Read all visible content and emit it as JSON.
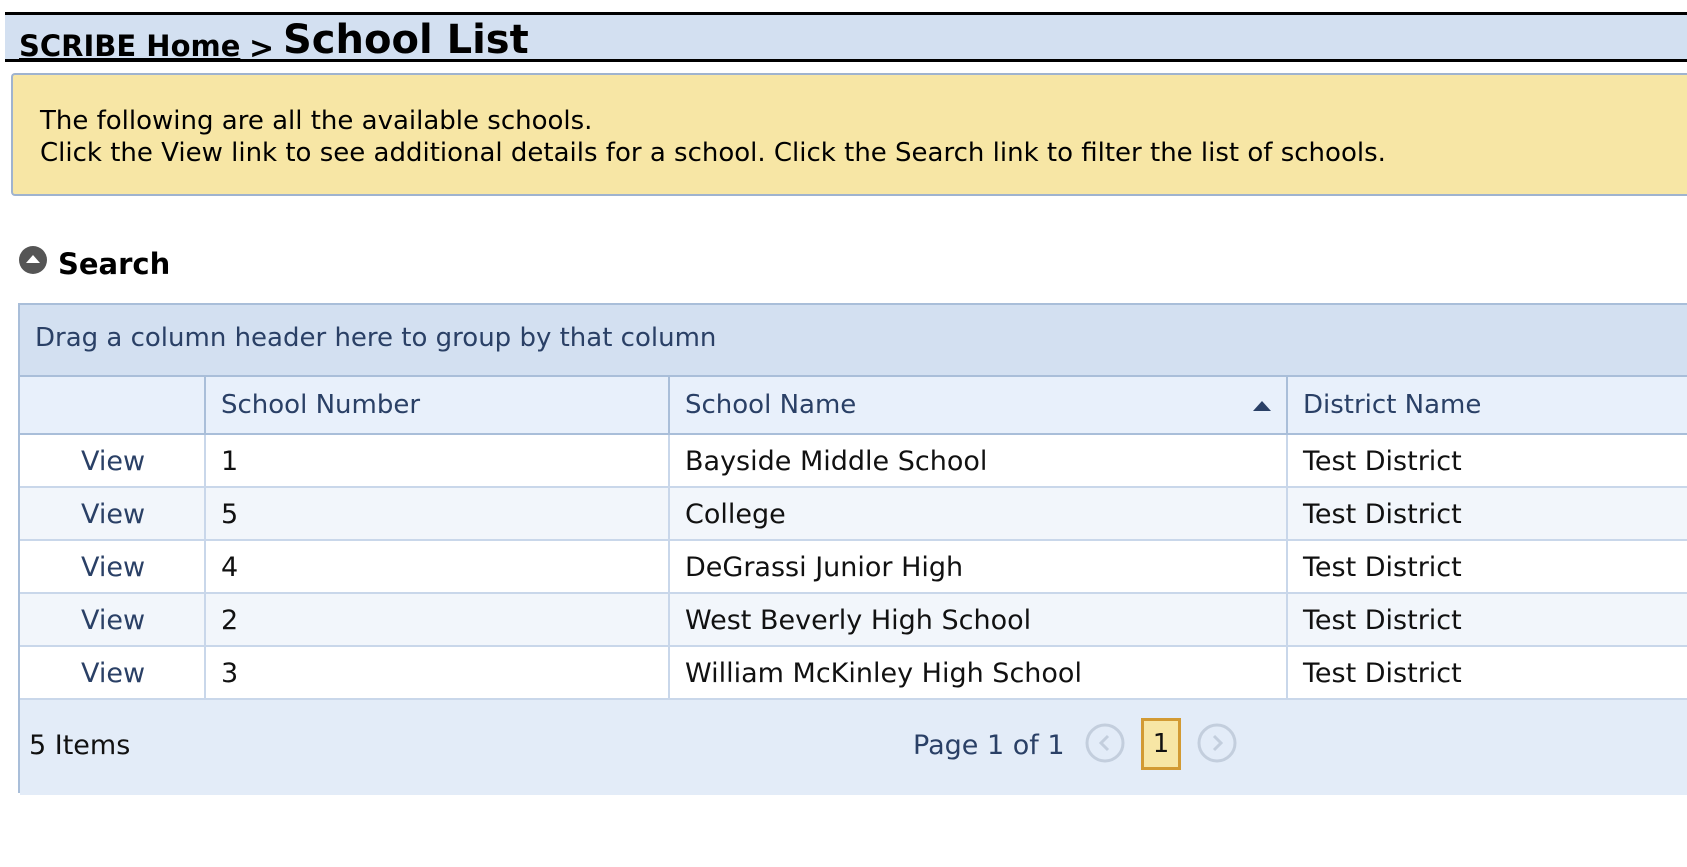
{
  "breadcrumb": {
    "home_label": "SCRIBE Home",
    "separator": ">",
    "current": "School List"
  },
  "info": {
    "line1": "The following are all the available schools.",
    "line2": "Click the View link to see additional details for a school. Click the Search link to filter the list of schools."
  },
  "search": {
    "label": "Search",
    "toggle_icon": "collapse-up-icon"
  },
  "grid": {
    "group_panel_text": "Drag a column header here to group by that column",
    "columns": [
      "",
      "School Number",
      "School Name",
      "District Name"
    ],
    "sorted_column": "School Name",
    "sort_direction": "ascending",
    "view_label": "View",
    "rows": [
      {
        "number": "1",
        "name": "Bayside Middle School",
        "district": "Test District"
      },
      {
        "number": "5",
        "name": "College",
        "district": "Test District"
      },
      {
        "number": "4",
        "name": "DeGrassi Junior High",
        "district": "Test District"
      },
      {
        "number": "2",
        "name": "West Beverly High School",
        "district": "Test District"
      },
      {
        "number": "3",
        "name": "William McKinley High School",
        "district": "Test District"
      }
    ]
  },
  "pager": {
    "items_text": "5 Items",
    "page_text": "Page 1 of 1",
    "current_page": "1"
  },
  "colors": {
    "header_bg": "#d3e0f1",
    "info_bg": "#f7e6a5",
    "accent": "#2a4066",
    "current_page_border": "#d29a33"
  }
}
